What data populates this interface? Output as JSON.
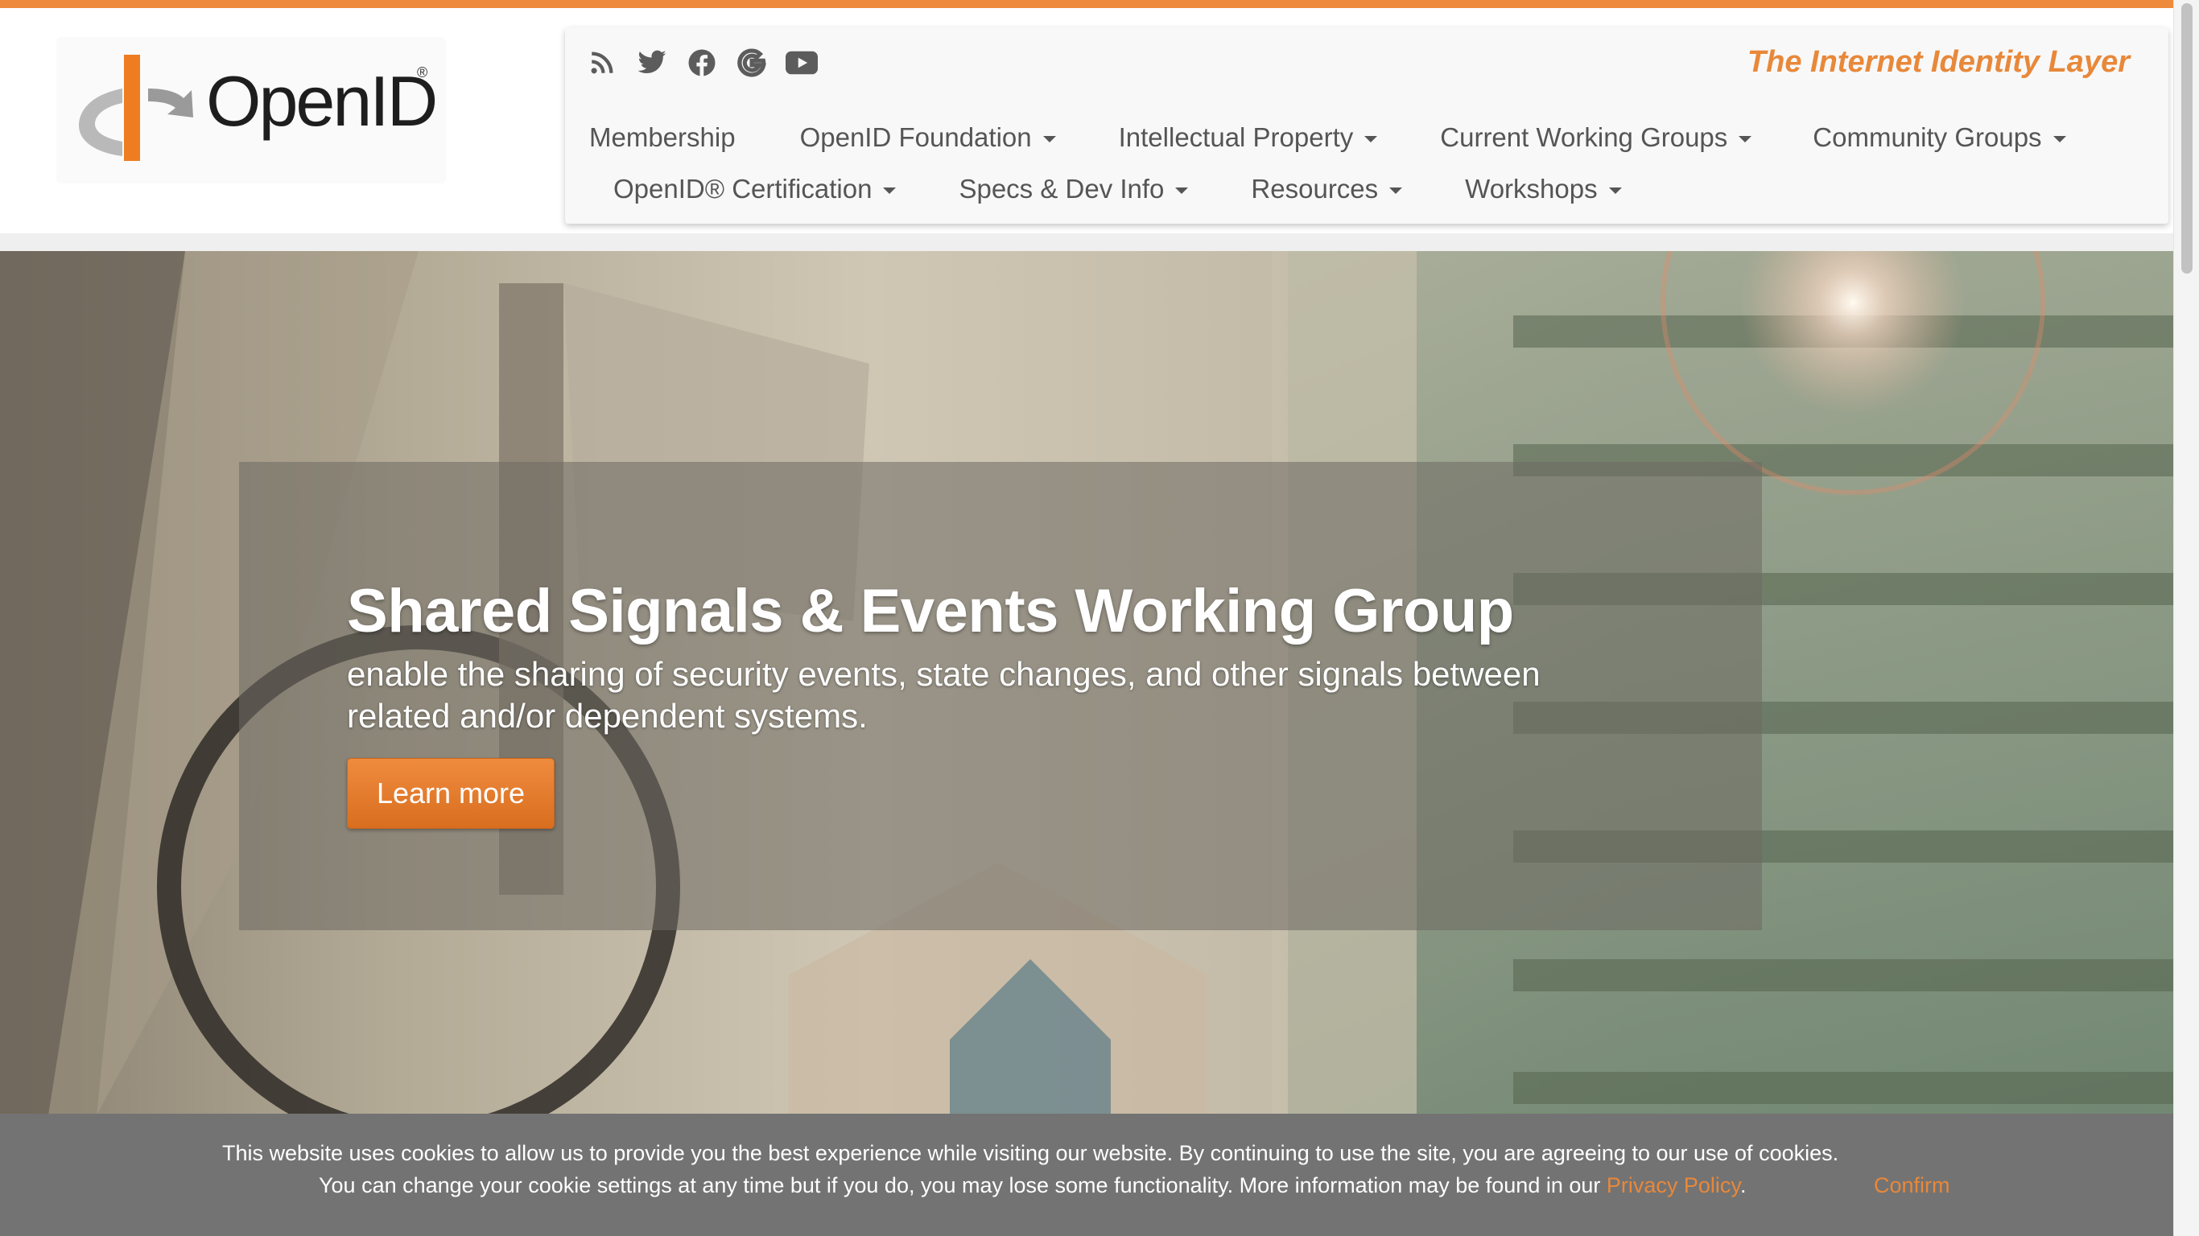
{
  "brand": {
    "logo_text": "OpenID",
    "logo_reg": "®",
    "tagline": "The Internet Identity Layer",
    "accent_color": "#ee8a3b"
  },
  "social_icons": [
    "rss-icon",
    "twitter-icon",
    "facebook-icon",
    "google-icon",
    "youtube-icon"
  ],
  "nav": {
    "row1": [
      {
        "label": "Membership",
        "dropdown": false
      },
      {
        "label": "OpenID Foundation",
        "dropdown": true
      },
      {
        "label": "Intellectual Property",
        "dropdown": true
      },
      {
        "label": "Current Working Groups",
        "dropdown": true
      },
      {
        "label": "Community Groups",
        "dropdown": true
      }
    ],
    "row2": [
      {
        "label": "OpenID® Certification",
        "dropdown": true
      },
      {
        "label": "Specs & Dev Info",
        "dropdown": true
      },
      {
        "label": "Resources",
        "dropdown": true
      },
      {
        "label": "Workshops",
        "dropdown": true
      }
    ]
  },
  "hero": {
    "title": "Shared Signals & Events Working Group",
    "subtitle": "enable the sharing of security events, state changes, and other signals between related and/or dependent systems.",
    "button_label": "Learn more"
  },
  "cookie": {
    "line1": "This website uses cookies to allow us to provide you the best experience while visiting our website. By continuing to use the site, you are agreeing to our use of cookies.",
    "line2_prefix": "You can change your cookie settings at any time but if you do, you may lose some functionality. More information may be found in our ",
    "link_label": "Privacy Policy",
    "line2_suffix": ".",
    "confirm_label": "Confirm"
  }
}
